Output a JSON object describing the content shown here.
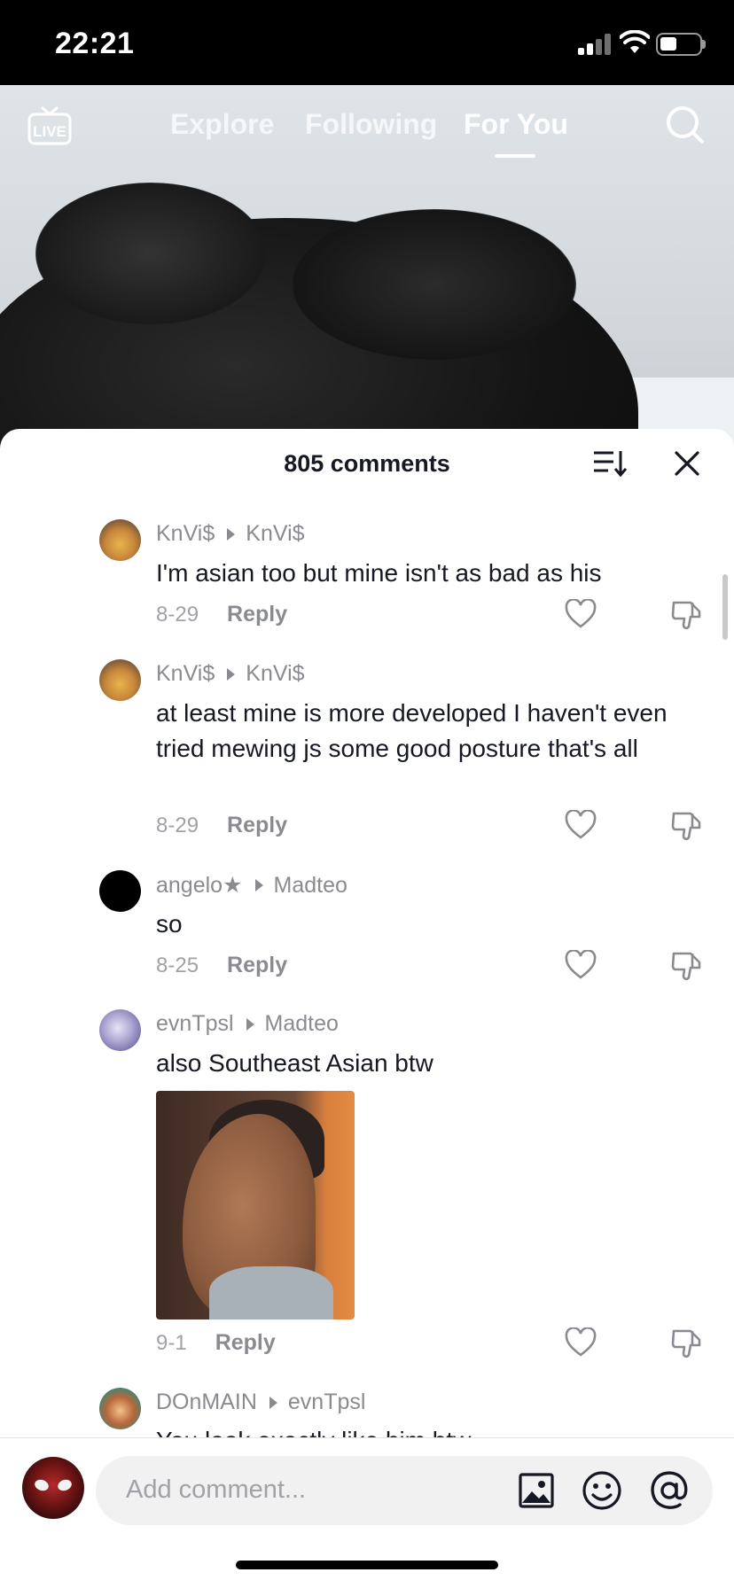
{
  "status_bar": {
    "time": "22:21"
  },
  "top_nav": {
    "live_label": "LIVE",
    "tabs": [
      {
        "label": "Explore",
        "active": false
      },
      {
        "label": "Following",
        "active": false
      },
      {
        "label": "For You",
        "active": true
      }
    ]
  },
  "comments_sheet": {
    "count_label": "805 comments",
    "comments": [
      {
        "author": "KnVi$",
        "reply_to": "KnVi$",
        "text": "I'm asian too but mine isn't as bad as his",
        "date": "8-29",
        "reply_label": "Reply"
      },
      {
        "author": "KnVi$",
        "reply_to": "KnVi$",
        "text": "at least mine is more developed I haven't even tried mewing js some good posture that's all",
        "date": "8-29",
        "reply_label": "Reply"
      },
      {
        "author": "angelo★",
        "reply_to": "Madteo",
        "text": "so",
        "date": "8-25",
        "reply_label": "Reply"
      },
      {
        "author": "evnTpsl",
        "reply_to": "Madteo",
        "text": "also Southeast Asian btw",
        "date": "9-1",
        "reply_label": "Reply"
      },
      {
        "author": "DOnMAIN",
        "reply_to": "evnTpsl",
        "text": "You look exactly like him btw"
      }
    ]
  },
  "input_bar": {
    "placeholder": "Add comment..."
  },
  "colors": {
    "text_primary": "#161823",
    "text_secondary": "#8a8b91",
    "sheet_bg": "#ffffff"
  }
}
